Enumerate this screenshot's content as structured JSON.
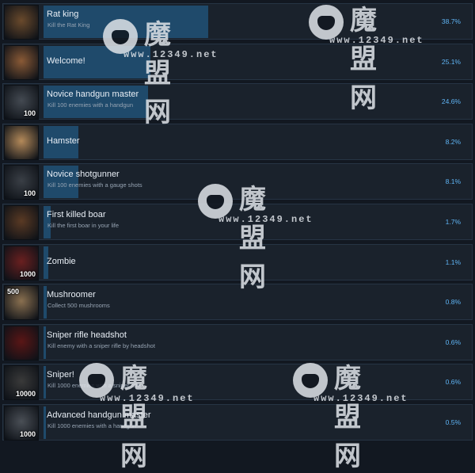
{
  "achievements": [
    {
      "title": "Rat king",
      "desc": "Kill the Rat King",
      "pct": "38.7%",
      "progress": 0.387,
      "badge": "",
      "badge_pos": "br",
      "icon": "rat-icon",
      "icon_color": "#6a4a2c"
    },
    {
      "title": "Welcome!",
      "desc": "",
      "pct": "25.1%",
      "progress": 0.251,
      "badge": "",
      "badge_pos": "br",
      "icon": "bread-icon",
      "icon_color": "#8a5a36"
    },
    {
      "title": "Novice handgun master",
      "desc": "Kill 100 enemies with a handgun",
      "pct": "24.6%",
      "progress": 0.246,
      "badge": "100",
      "badge_pos": "br",
      "icon": "handgun-icon",
      "icon_color": "#444a52"
    },
    {
      "title": "Hamster",
      "desc": "",
      "pct": "8.2%",
      "progress": 0.082,
      "badge": "",
      "badge_pos": "br",
      "icon": "hamster-icon",
      "icon_color": "#b48a5a"
    },
    {
      "title": "Novice shotgunner",
      "desc": "Kill 100 enemies with a gauge shots",
      "pct": "8.1%",
      "progress": 0.081,
      "badge": "100",
      "badge_pos": "br",
      "icon": "shotgun-icon",
      "icon_color": "#3a3f46"
    },
    {
      "title": "First killed boar",
      "desc": "Kill the first boar in your life",
      "pct": "1.7%",
      "progress": 0.017,
      "badge": "",
      "badge_pos": "br",
      "icon": "boar-icon",
      "icon_color": "#5a3a24"
    },
    {
      "title": "Zombie",
      "desc": "",
      "pct": "1.1%",
      "progress": 0.011,
      "badge": "1000",
      "badge_pos": "br",
      "icon": "zombie-icon",
      "icon_color": "#6a2020"
    },
    {
      "title": "Mushroomer",
      "desc": "Collect 500 mushrooms",
      "pct": "0.8%",
      "progress": 0.008,
      "badge": "500",
      "badge_pos": "tl",
      "icon": "mushroom-icon",
      "icon_color": "#8a7050"
    },
    {
      "title": "Sniper rifle headshot",
      "desc": "Kill enemy with a sniper rifle by headshot",
      "pct": "0.6%",
      "progress": 0.006,
      "badge": "",
      "badge_pos": "br",
      "icon": "crosshair-icon",
      "icon_color": "#5a1616"
    },
    {
      "title": "Sniper!",
      "desc": "Kill 1000 enemies with a sniper rifle",
      "pct": "0.6%",
      "progress": 0.006,
      "badge": "10000",
      "badge_pos": "br",
      "icon": "sniper-rifle-icon",
      "icon_color": "#3a3a3a"
    },
    {
      "title": "Advanced handgun master",
      "desc": "Kill 1000 enemies with a handgun",
      "pct": "0.5%",
      "progress": 0.005,
      "badge": "1000",
      "badge_pos": "br",
      "icon": "handgun-icon",
      "icon_color": "#4a4f56"
    }
  ],
  "watermark": {
    "cjk": "魔盟网",
    "url": "www.12349.net"
  },
  "colors": {
    "bar": "#1f4a6b",
    "pct_text": "#5fb4f4",
    "row_bg": "#1a222c"
  }
}
